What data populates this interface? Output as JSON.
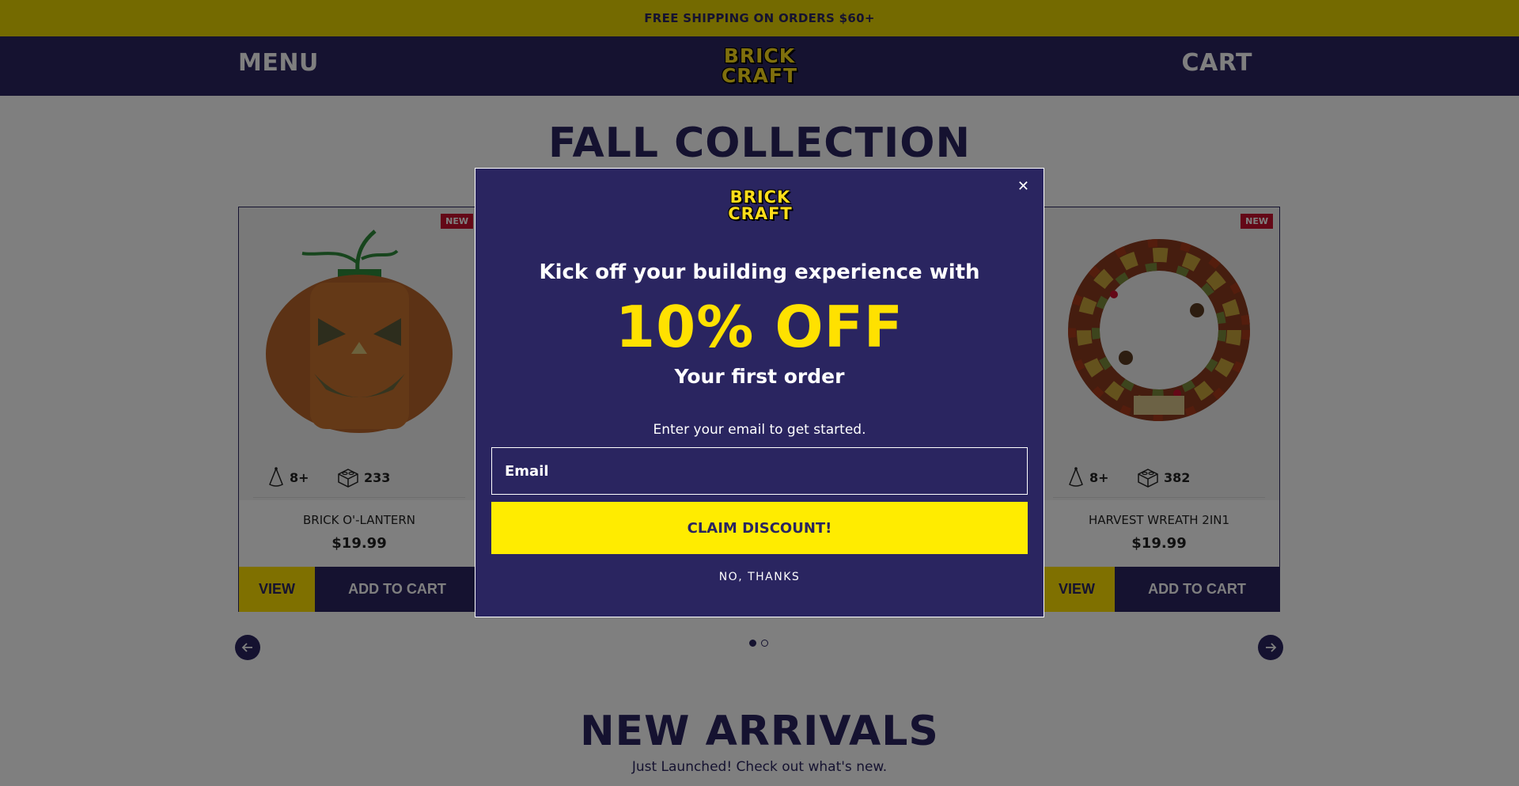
{
  "announcement": {
    "text": "FREE SHIPPING ON ORDERS $60+"
  },
  "header": {
    "menu_label": "MENU",
    "cart_label": "CART",
    "logo_line1": "BRICK",
    "logo_line2": "CRAFT"
  },
  "fall_collection": {
    "title": "FALL COLLECTION",
    "products": [
      {
        "badge": "NEW",
        "age": "8+",
        "pieces": "233",
        "name": "BRICK O'-LANTERN",
        "price": "$19.99",
        "view_label": "VIEW",
        "add_label": "ADD TO CART"
      },
      {
        "badge": "NEW",
        "age": "8+",
        "pieces": "382",
        "name": "HARVEST WREATH 2IN1",
        "price": "$19.99",
        "view_label": "VIEW",
        "add_label": "ADD TO CART"
      }
    ],
    "carousel": {
      "pages": 2,
      "current": 1
    }
  },
  "new_arrivals": {
    "title": "NEW ARRIVALS",
    "subtitle": "Just Launched! Check out what's new."
  },
  "modal": {
    "close_symbol": "✕",
    "logo_line1": "BRICK",
    "logo_line2": "CRAFT",
    "headline": "Kick off your building experience with",
    "offer": "10% OFF",
    "subheadline": "Your first order",
    "prompt": "Enter your email to get started.",
    "email_placeholder": "Email",
    "claim_label": "CLAIM DISCOUNT!",
    "dismiss_label": "NO, THANKS"
  },
  "colors": {
    "brand_navy": "#2a2560",
    "brand_yellow": "#ffe100",
    "badge_red": "#c8102e"
  },
  "icons": [
    "party-hat-icon",
    "brick-icon",
    "arrow-left-icon",
    "arrow-right-icon",
    "close-icon"
  ]
}
